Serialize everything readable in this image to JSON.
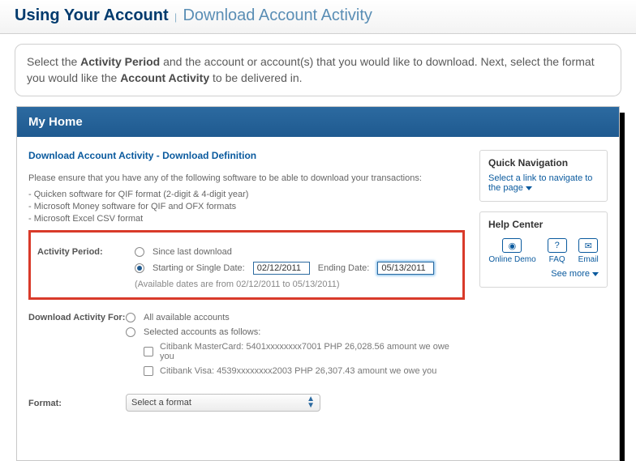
{
  "header": {
    "title": "Using Your Account",
    "subtitle": "Download Account Activity"
  },
  "instruction": {
    "part1": "Select the ",
    "bold1": "Activity Period",
    "part2": " and the account or account(s) that you would like to download. Next, select the format you would like the ",
    "bold2": "Account Activity",
    "part3": " to be delivered in."
  },
  "tabbar": {
    "home": "My Home"
  },
  "main": {
    "section_title": "Download Account Activity - Download Definition",
    "help_intro": "Please ensure that you have any of the following software to be able to download your transactions:",
    "help_l1": "- Quicken software for QIF format (2-digit & 4-digit year)",
    "help_l2": "- Microsoft Money software for QIF and OFX formats",
    "help_l3": "- Microsoft Excel CSV format",
    "activity_period": {
      "label": "Activity Period:",
      "opt_since": "Since last download",
      "opt_range_prefix": "Starting or Single Date:",
      "start_date": "02/12/2011",
      "ending_label": "Ending Date:",
      "end_date": "05/13/2011",
      "note": "(Available dates are from 02/12/2011 to 05/13/2011)"
    },
    "download_for": {
      "label": "Download Activity For:",
      "opt_all": "All available accounts",
      "opt_sel": "Selected accounts as follows:",
      "acc1": "Citibank MasterCard: 5401xxxxxxxx7001 PHP 26,028.56 amount we owe you",
      "acc2": "Citibank Visa: 4539xxxxxxxx2003 PHP 26,307.43 amount we owe you"
    },
    "format": {
      "label": "Format:",
      "placeholder": "Select a format"
    }
  },
  "sidebar": {
    "quicknav": {
      "title": "Quick Navigation",
      "link": "Select a link to navigate to the page"
    },
    "helpcenter": {
      "title": "Help Center",
      "demo": "Online Demo",
      "faq": "FAQ",
      "email": "Email",
      "see_more": "See more"
    }
  }
}
